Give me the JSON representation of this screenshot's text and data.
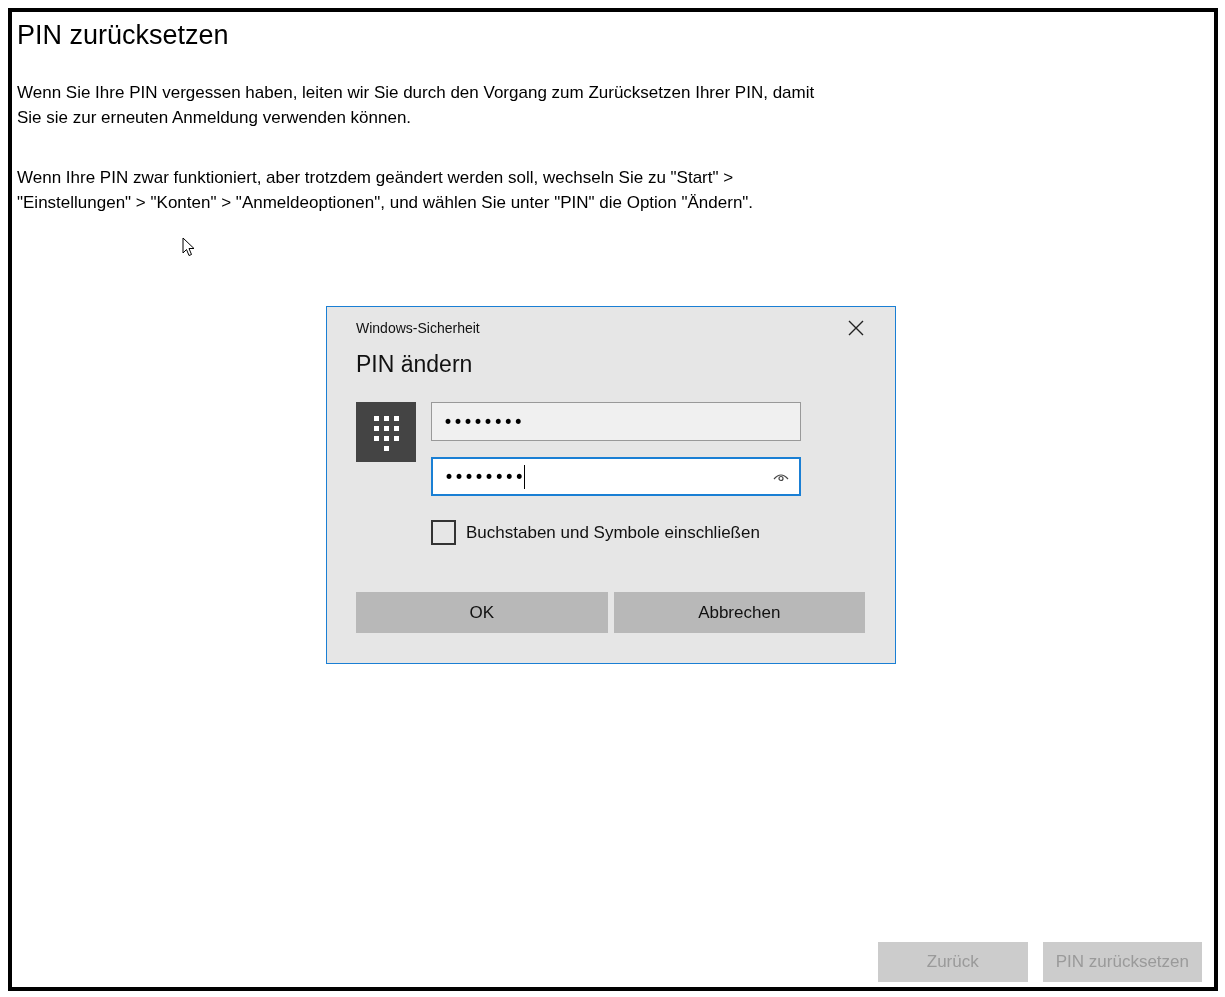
{
  "page": {
    "title": "PIN zurücksetzen",
    "paragraphs": [
      "Wenn Sie Ihre PIN vergessen haben, leiten wir Sie durch den Vorgang zum Zurücksetzen Ihrer PIN, damit Sie sie zur erneuten Anmeldung verwenden können.",
      "Wenn Ihre PIN zwar funktioniert, aber trotzdem geändert werden soll, wechseln Sie zu \"Start\" > \"Einstellungen\" > \"Konten\" > \"Anmeldeoptionen\", und wählen Sie unter \"PIN\" die Option \"Ändern\"."
    ]
  },
  "dialog": {
    "caption": "Windows-Sicherheit",
    "heading": "PIN ändern",
    "fields": [
      {
        "value": "••••••••",
        "focused": false,
        "reveal_icon": false
      },
      {
        "value": "••••••••",
        "focused": true,
        "reveal_icon": true
      }
    ],
    "checkbox": {
      "label": "Buchstaben und Symbole einschließen",
      "checked": false
    },
    "buttons": [
      "OK",
      "Abbrechen"
    ]
  },
  "footer_buttons": [
    {
      "label": "Zurück",
      "disabled": true
    },
    {
      "label": "PIN zurücksetzen",
      "disabled": true
    }
  ]
}
